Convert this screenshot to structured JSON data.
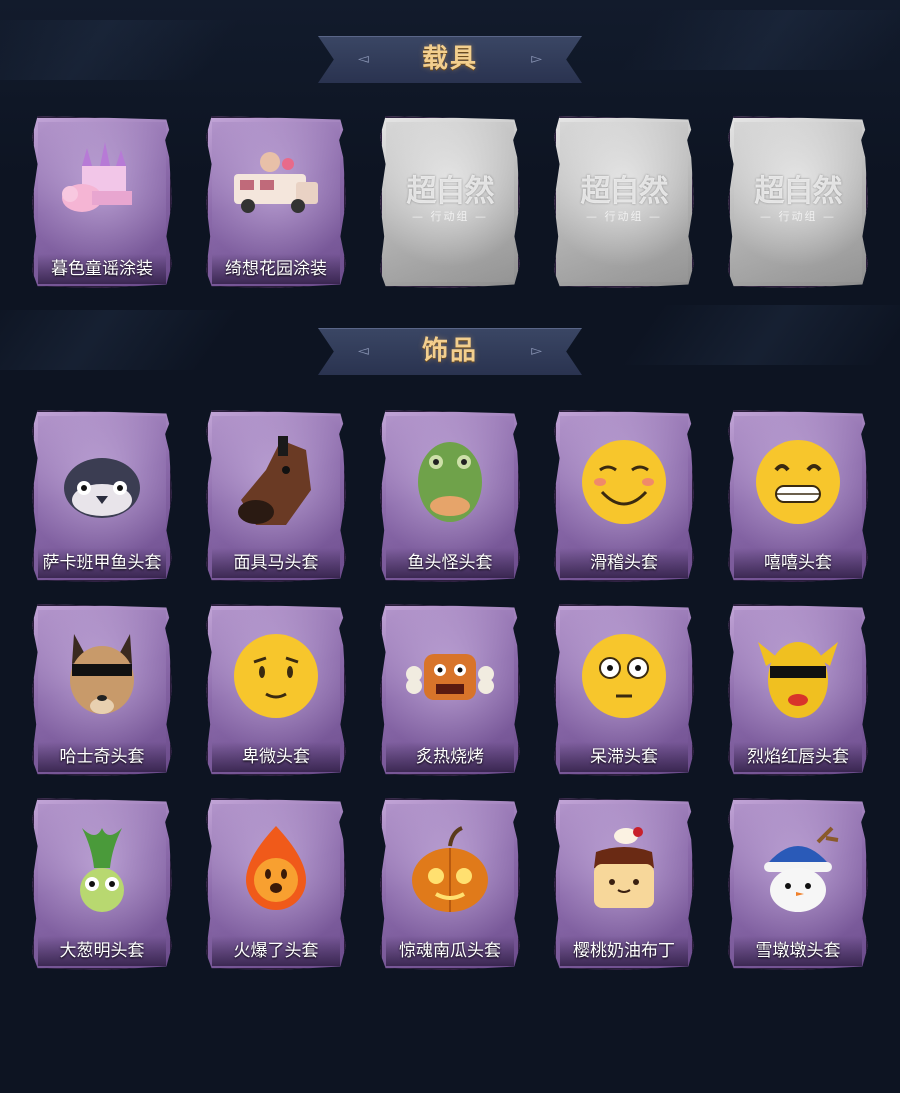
{
  "sections": [
    {
      "title": "载具",
      "items": [
        {
          "label": "暮色童谣涂装",
          "icon": "castle-elephant-vehicle-icon",
          "locked": false
        },
        {
          "label": "绮想花园涂装",
          "icon": "garden-truck-vehicle-icon",
          "locked": false
        },
        {
          "label": "",
          "icon": "placeholder-logo-icon",
          "locked": true
        },
        {
          "label": "",
          "icon": "placeholder-logo-icon",
          "locked": true
        },
        {
          "label": "",
          "icon": "placeholder-logo-icon",
          "locked": true
        }
      ]
    },
    {
      "title": "饰品",
      "items": [
        {
          "label": "萨卡班甲鱼头套",
          "icon": "fish-head-icon"
        },
        {
          "label": "面具马头套",
          "icon": "horse-mask-icon"
        },
        {
          "label": "鱼头怪头套",
          "icon": "green-fish-face-icon"
        },
        {
          "label": "滑稽头套",
          "icon": "funny-face-emoji-icon"
        },
        {
          "label": "嘻嘻头套",
          "icon": "grin-emoji-icon"
        },
        {
          "label": "哈士奇头套",
          "icon": "husky-sunglasses-icon"
        },
        {
          "label": "卑微头套",
          "icon": "humble-emoji-icon"
        },
        {
          "label": "炙热烧烤",
          "icon": "bbq-meat-icon"
        },
        {
          "label": "呆滞头套",
          "icon": "blank-stare-emoji-icon"
        },
        {
          "label": "烈焰红唇头套",
          "icon": "yellow-mask-sunglasses-icon"
        },
        {
          "label": "大葱明头套",
          "icon": "scallion-head-icon"
        },
        {
          "label": "火爆了头套",
          "icon": "fireball-icon"
        },
        {
          "label": "惊魂南瓜头套",
          "icon": "pumpkin-icon"
        },
        {
          "label": "樱桃奶油布丁",
          "icon": "pudding-icon"
        },
        {
          "label": "雪墩墩头套",
          "icon": "snowman-icon"
        }
      ]
    }
  ],
  "placeholder_logo": {
    "main": "超自然",
    "sub": "— 行动组 —"
  },
  "colors": {
    "background": "#0d1422",
    "title": "#f3cf8e",
    "card_purple": "#8b6aaa",
    "card_grey": "#b8b8b8"
  }
}
